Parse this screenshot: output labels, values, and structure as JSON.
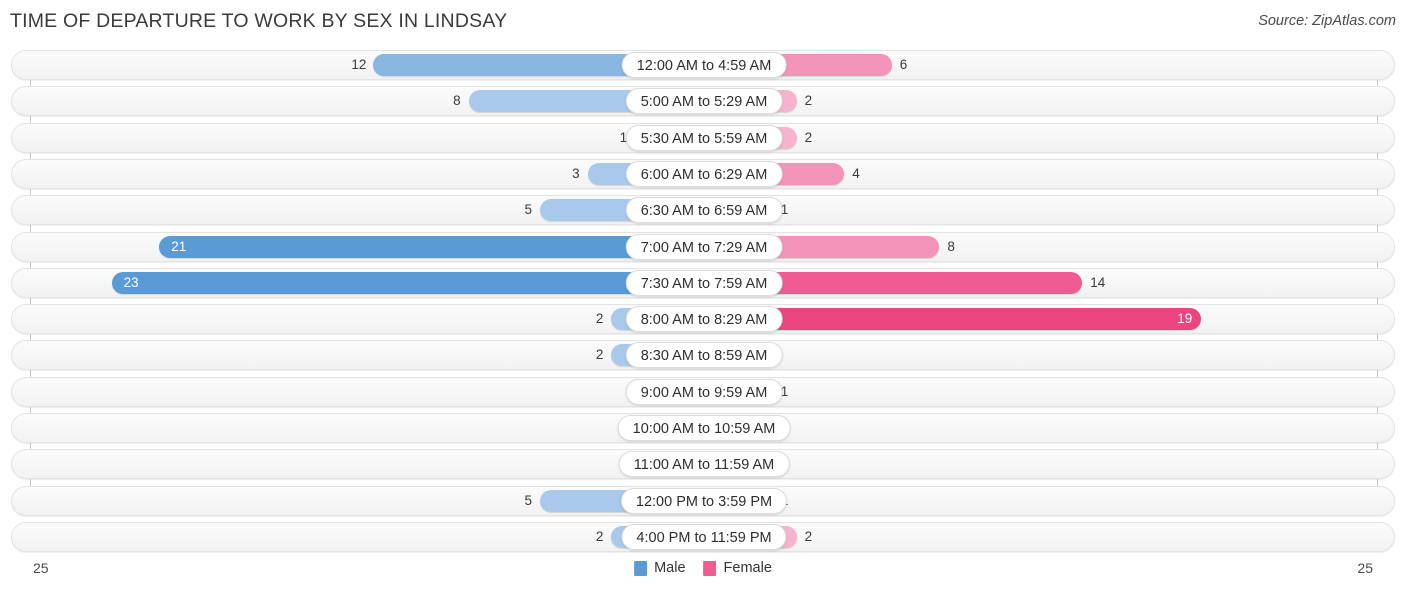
{
  "header": {
    "title": "TIME OF DEPARTURE TO WORK BY SEX IN LINDSAY",
    "source": "Source: ZipAtlas.com"
  },
  "footer": {
    "axis_left": "25",
    "axis_right": "25"
  },
  "legend": [
    {
      "label": "Male",
      "color": "#5b9bd5"
    },
    {
      "label": "Female",
      "color": "#ef5b92"
    }
  ],
  "colors": {
    "male_light": "#a8c9ea",
    "male_mid": "#8ab6e2",
    "male_dark": "#5b9bd5",
    "female_light": "#f7b3cd",
    "female_mid": "#f493b8",
    "female_dark": "#ef5b92",
    "female_max": "#ea457f",
    "track": "#f4f4f4",
    "axis": "#c9c9c9"
  },
  "chart_data": {
    "type": "bar",
    "title": "TIME OF DEPARTURE TO WORK BY SEX IN LINDSAY",
    "subtitle": "",
    "xlabel": "",
    "ylabel": "",
    "orientation": "horizontal",
    "style": "diverging-bidirectional",
    "xlim": [
      25,
      25
    ],
    "axis_max": 25,
    "grid": false,
    "legend_position": "bottom-center",
    "categories": [
      "12:00 AM to 4:59 AM",
      "5:00 AM to 5:29 AM",
      "5:30 AM to 5:59 AM",
      "6:00 AM to 6:29 AM",
      "6:30 AM to 6:59 AM",
      "7:00 AM to 7:29 AM",
      "7:30 AM to 7:59 AM",
      "8:00 AM to 8:29 AM",
      "8:30 AM to 8:59 AM",
      "9:00 AM to 9:59 AM",
      "10:00 AM to 10:59 AM",
      "11:00 AM to 11:59 AM",
      "12:00 PM to 3:59 PM",
      "4:00 PM to 11:59 PM"
    ],
    "series": [
      {
        "name": "Male",
        "color": "#5b9bd5",
        "values": [
          12,
          8,
          1,
          3,
          5,
          21,
          23,
          2,
          2,
          0,
          0,
          0,
          5,
          2
        ]
      },
      {
        "name": "Female",
        "color": "#ef5b92",
        "values": [
          6,
          2,
          2,
          4,
          1,
          8,
          14,
          19,
          0,
          1,
          0,
          0,
          1,
          2
        ]
      }
    ]
  },
  "rows": [
    {
      "label": "12:00 AM to 4:59 AM",
      "male": 12,
      "female": 6
    },
    {
      "label": "5:00 AM to 5:29 AM",
      "male": 8,
      "female": 2
    },
    {
      "label": "5:30 AM to 5:59 AM",
      "male": 1,
      "female": 2
    },
    {
      "label": "6:00 AM to 6:29 AM",
      "male": 3,
      "female": 4
    },
    {
      "label": "6:30 AM to 6:59 AM",
      "male": 5,
      "female": 1
    },
    {
      "label": "7:00 AM to 7:29 AM",
      "male": 21,
      "female": 8
    },
    {
      "label": "7:30 AM to 7:59 AM",
      "male": 23,
      "female": 14
    },
    {
      "label": "8:00 AM to 8:29 AM",
      "male": 2,
      "female": 19
    },
    {
      "label": "8:30 AM to 8:59 AM",
      "male": 2,
      "female": 0
    },
    {
      "label": "9:00 AM to 9:59 AM",
      "male": 0,
      "female": 1
    },
    {
      "label": "10:00 AM to 10:59 AM",
      "male": 0,
      "female": 0
    },
    {
      "label": "11:00 AM to 11:59 AM",
      "male": 0,
      "female": 0
    },
    {
      "label": "12:00 PM to 3:59 PM",
      "male": 5,
      "female": 1
    },
    {
      "label": "4:00 PM to 11:59 PM",
      "male": 2,
      "female": 2
    }
  ]
}
